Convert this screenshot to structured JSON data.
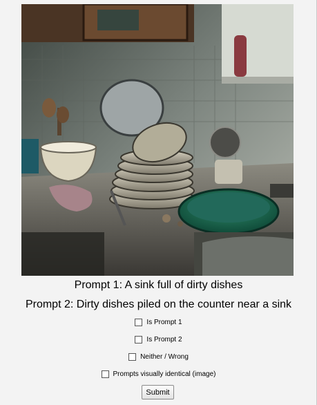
{
  "image": {
    "icon": "photo-dirty-dishes"
  },
  "prompts": {
    "prompt_1": "Prompt 1: A sink full of dirty dishes",
    "prompt_2": "Prompt 2: Dirty dishes piled on the counter near a sink"
  },
  "options": [
    {
      "label": "Is Prompt 1",
      "checked": false
    },
    {
      "label": "Is Prompt 2",
      "checked": false
    },
    {
      "label": "Neither / Wrong",
      "checked": false
    },
    {
      "label": "Prompts visually identical (image)",
      "checked": false
    }
  ],
  "submit_label": "Submit"
}
